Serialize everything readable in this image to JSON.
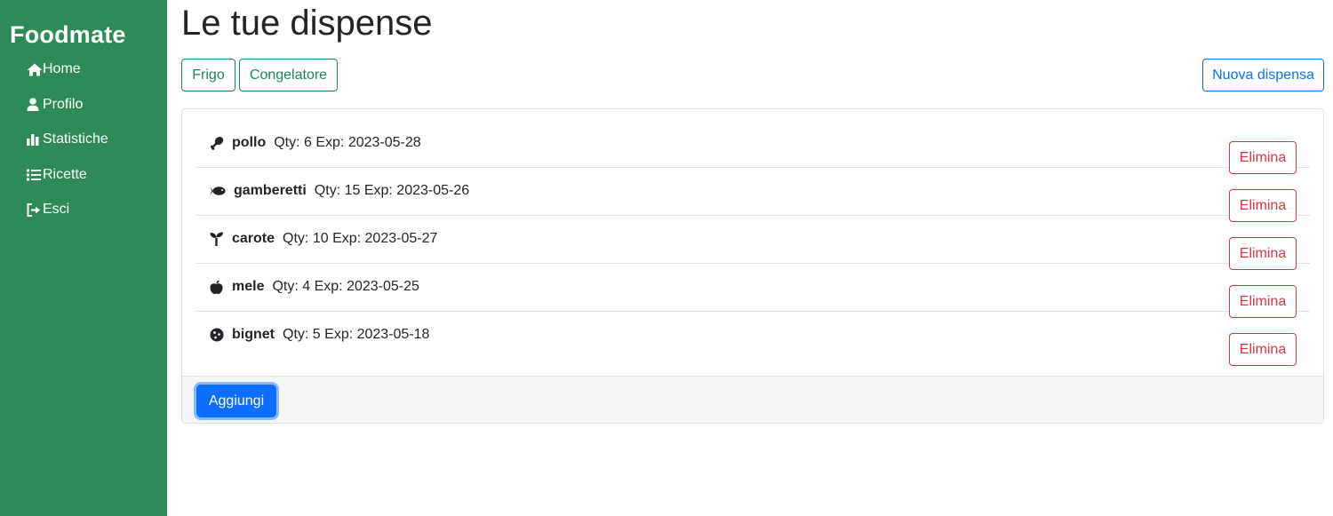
{
  "app": {
    "brand": "Foodmate",
    "nav": [
      {
        "label": "Home",
        "icon": "home-icon"
      },
      {
        "label": "Profilo",
        "icon": "user-icon"
      },
      {
        "label": "Statistiche",
        "icon": "bar-chart-icon"
      },
      {
        "label": "Ricette",
        "icon": "list-icon"
      },
      {
        "label": "Esci",
        "icon": "logout-icon"
      }
    ]
  },
  "colors": {
    "sidebar": "#2e8b57",
    "success": "#198754",
    "primary": "#0d6efd",
    "danger": "#dc3545"
  },
  "page": {
    "title": "Le tue dispense",
    "tabs": [
      {
        "label": "Frigo"
      },
      {
        "label": "Congelatore"
      }
    ],
    "new_pantry_label": "Nuova dispensa",
    "add_label": "Aggiungi"
  },
  "items": [
    {
      "icon": "drumstick-icon",
      "name": "pollo",
      "qty": "Qty: 6",
      "exp": "Exp: 2023-05-28",
      "delete_label": "Elimina"
    },
    {
      "icon": "fish-icon",
      "name": "gamberetti",
      "qty": "Qty: 15",
      "exp": "Exp: 2023-05-26",
      "delete_label": "Elimina"
    },
    {
      "icon": "seedling-icon",
      "name": "carote",
      "qty": "Qty: 10",
      "exp": "Exp: 2023-05-27",
      "delete_label": "Elimina"
    },
    {
      "icon": "apple-icon",
      "name": "mele",
      "qty": "Qty: 4",
      "exp": "Exp: 2023-05-25",
      "delete_label": "Elimina"
    },
    {
      "icon": "cookie-icon",
      "name": "bignet",
      "qty": "Qty: 5",
      "exp": "Exp: 2023-05-18",
      "delete_label": "Elimina"
    }
  ]
}
